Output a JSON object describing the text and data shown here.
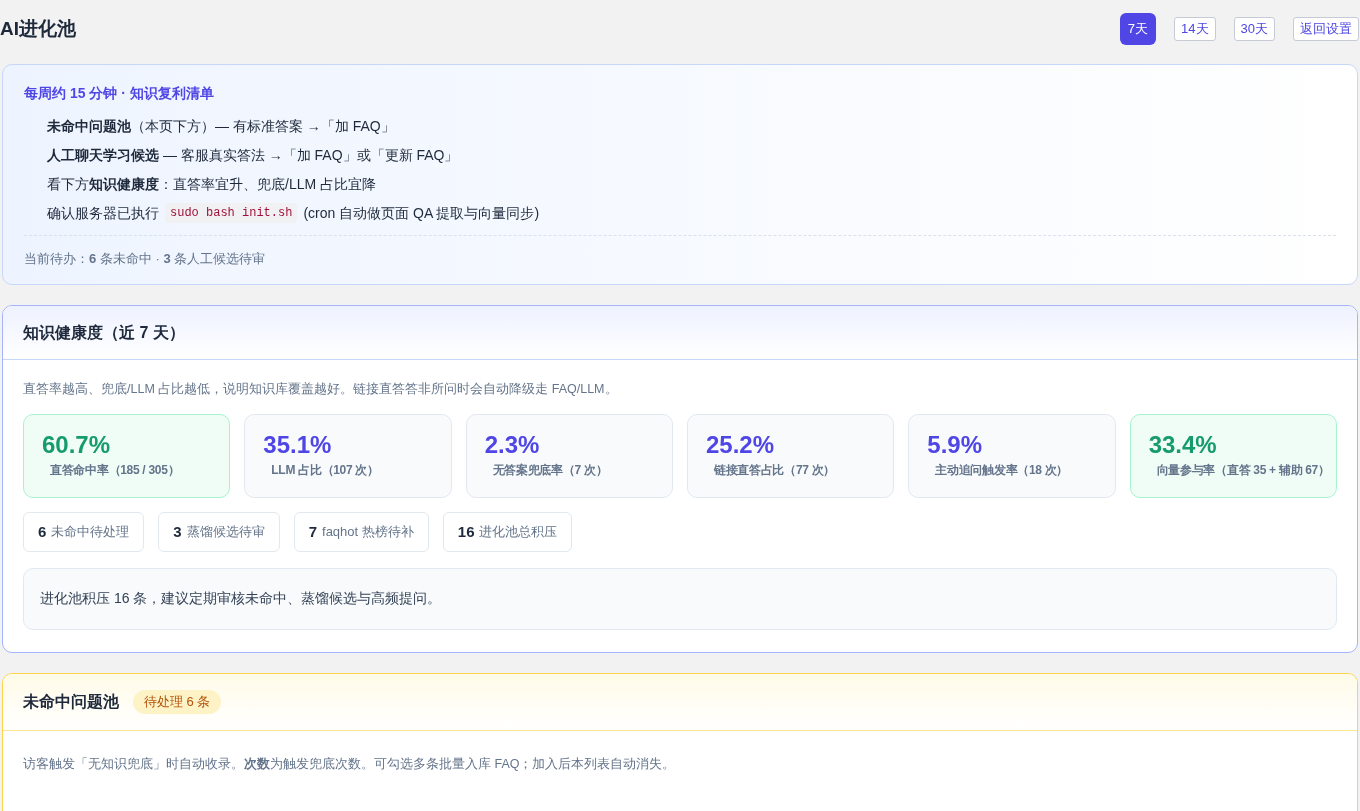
{
  "title": "AI进化池",
  "ranges": [
    {
      "label": "7天",
      "selected": true
    },
    {
      "label": "14天",
      "selected": false
    },
    {
      "label": "30天",
      "selected": false
    }
  ],
  "back_button": "返回设置",
  "checklist": {
    "heading": "每周约 15 分钟 · 知识复利清单",
    "items": [
      {
        "text": "**未命中问题池**（本页下方）— 有标准答案 →「加 FAQ」"
      },
      {
        "text": "**人工聊天学习候选** — 客服真实答法 →「加 FAQ」或「更新 FAQ」"
      },
      {
        "text": "看下方**知识健康度**：直答率宜升、兜底/LLM 占比宜降"
      },
      {
        "text": "确认服务器已执行",
        "code": "sudo bash init.sh",
        "after": "(cron 自动做页面 QA 提取与向量同步)"
      }
    ],
    "pending": "当前待办：**6** 条未命中 · **3** 条人工候选待审"
  },
  "health": {
    "title": "知识健康度（近 7 天）",
    "description": "直答率越高、兜底/LLM 占比越低，说明知识库覆盖越好。链接直答答非所问时会自动降级走 FAQ/LLM。",
    "metrics": [
      {
        "value": "60.7%",
        "label": "直答命中率（185 / 305）",
        "kind": "good"
      },
      {
        "value": "35.1%",
        "label": "LLM 占比（107 次）",
        "kind": "normal"
      },
      {
        "value": "2.3%",
        "label": "无答案兜底率（7 次）",
        "kind": "normal"
      },
      {
        "value": "25.2%",
        "label": "链接直答占比（77 次）",
        "kind": "normal"
      },
      {
        "value": "5.9%",
        "label": "主动追问触发率（18 次）",
        "kind": "normal"
      },
      {
        "value": "33.4%",
        "label": "向量参与率（直答 35 + 辅助 67）",
        "kind": "good"
      }
    ],
    "counts": [
      {
        "count": "6",
        "label": "未命中待处理"
      },
      {
        "count": "3",
        "label": "蒸馏候选待审"
      },
      {
        "count": "7",
        "label": "faqhot 热榜待补"
      },
      {
        "count": "16",
        "label": "进化池总积压"
      }
    ],
    "notice": "进化池积压 16 条，建议定期审核未命中、蒸馏候选与高频提问。"
  },
  "missed": {
    "title": "未命中问题池",
    "badge": "待处理 6 条",
    "description": "访客触发「无知识兜底」时自动收录。**次数**为触发兜底次数。可勾选多条批量入库 FAQ；加入后本列表自动消失。"
  }
}
